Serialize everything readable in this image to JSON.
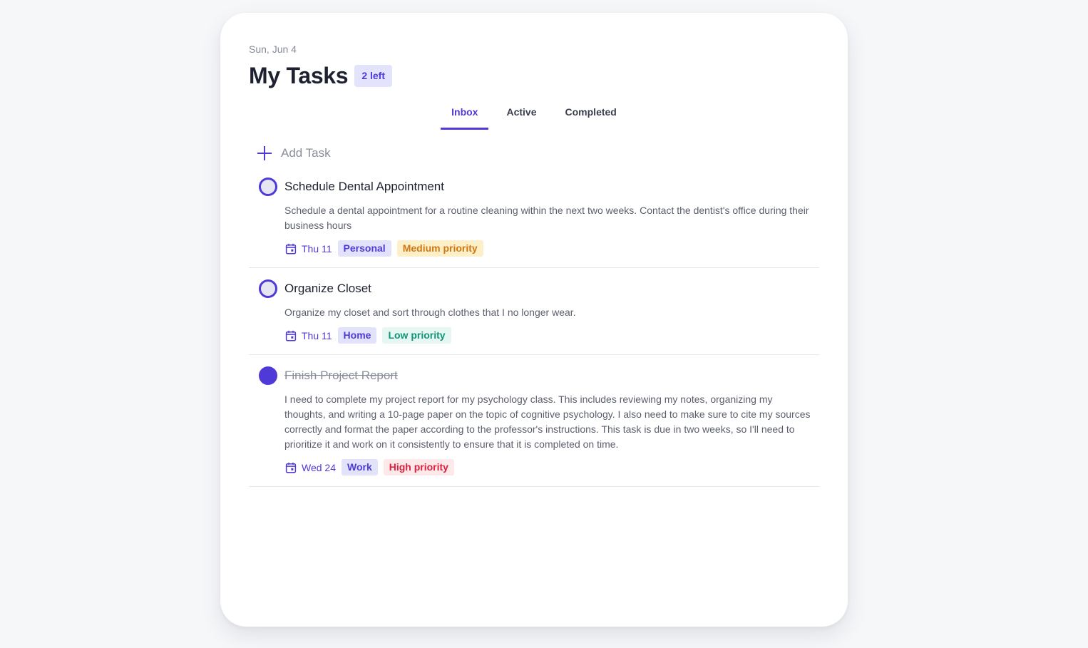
{
  "header": {
    "date": "Sun, Jun 4",
    "title": "My Tasks",
    "remaining_badge": "2 left"
  },
  "tabs": [
    {
      "label": "Inbox",
      "active": true
    },
    {
      "label": "Active",
      "active": false
    },
    {
      "label": "Completed",
      "active": false
    }
  ],
  "add_task": {
    "label": "Add Task",
    "icon": "plus-icon"
  },
  "tasks": [
    {
      "title": "Schedule Dental Appointment",
      "completed": false,
      "description": "Schedule a dental appointment for a routine cleaning within the next two weeks. Contact the dentist's office during their business hours",
      "due": "Thu 11",
      "category": "Personal",
      "priority": "Medium priority",
      "priority_level": "medium"
    },
    {
      "title": "Organize Closet",
      "completed": false,
      "description": "Organize my closet and sort through clothes that I no longer wear.",
      "due": "Thu 11",
      "category": "Home",
      "priority": "Low priority",
      "priority_level": "low"
    },
    {
      "title": "Finish Project Report",
      "completed": true,
      "description": "I need to complete my project report for my psychology class. This includes reviewing my notes, organizing my thoughts, and writing a 10-page paper on the topic of cognitive psychology. I also need to make sure to cite my sources correctly and format the paper according to the professor's instructions. This task is due in two weeks, so I'll need to prioritize it and work on it consistently to ensure that it is completed on time.",
      "due": "Wed 24",
      "category": "Work",
      "priority": "High priority",
      "priority_level": "high"
    }
  ],
  "colors": {
    "accent": "#4f3ad8",
    "medium_priority": "#d17812",
    "low_priority": "#0f9477",
    "high_priority": "#dc2140"
  }
}
